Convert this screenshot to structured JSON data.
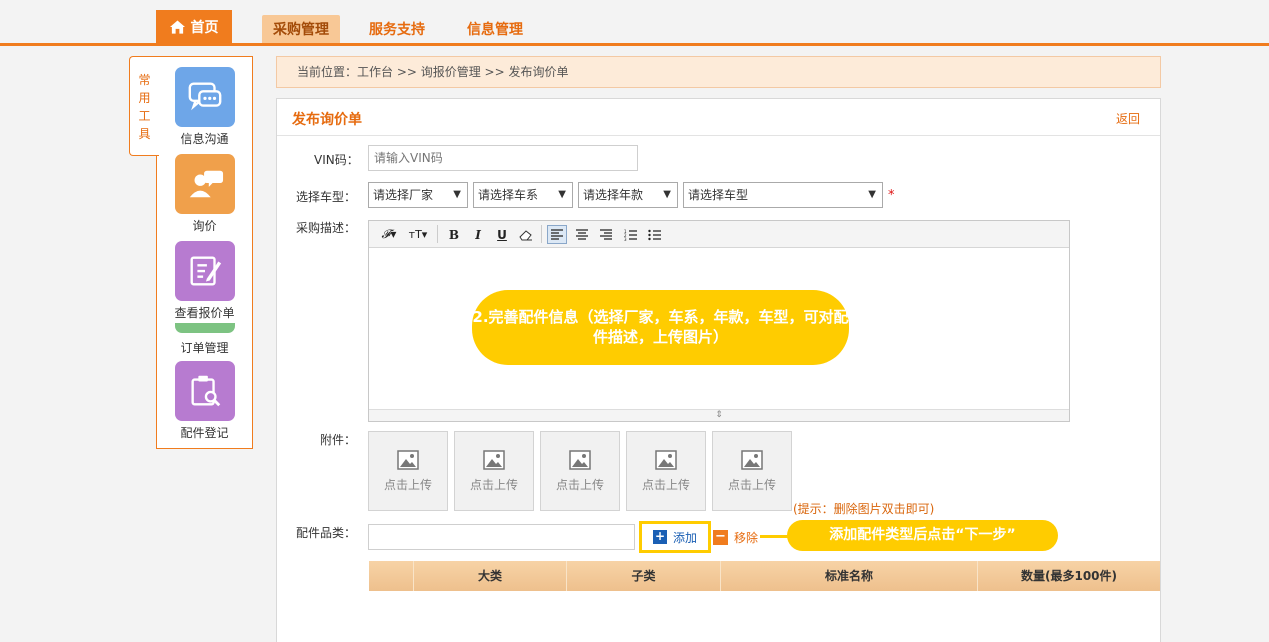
{
  "nav": {
    "home": "首页",
    "tabs": [
      {
        "label": "采购管理",
        "active": true
      },
      {
        "label": "服务支持",
        "active": false
      },
      {
        "label": "信息管理",
        "active": false
      }
    ]
  },
  "sidebar": {
    "tab_label": "常\n用\n工\n具",
    "tools": [
      {
        "label": "信息沟通",
        "icon": "chat-icon"
      },
      {
        "label": "询价",
        "icon": "user-chat-icon"
      },
      {
        "label": "查看报价单",
        "icon": "edit-icon"
      },
      {
        "label": "订单管理",
        "icon": "order-icon"
      },
      {
        "label": "配件登记",
        "icon": "clipboard-search-icon"
      }
    ]
  },
  "breadcrumb": "当前位置：工作台 >> 询报价管理 >> 发布询价单",
  "form": {
    "title": "发布询价单",
    "back": "返回",
    "vin_label": "VIN码：",
    "vin_placeholder": "请输入VIN码",
    "model_label": "选择车型：",
    "selects": [
      "请选择厂家",
      "请选择车系",
      "请选择年款",
      "请选择车型"
    ],
    "required_mark": "*",
    "desc_label": "采购描述：",
    "attach_label": "附件：",
    "upload_text": "点击上传",
    "upload_count": 5,
    "hint": "(提示：删除图片双击即可)",
    "parts_label": "配件品类：",
    "add_btn": "添加",
    "remove_btn": "移除"
  },
  "callouts": {
    "step2": "2.完善配件信息（选择厂家，车系，年款，车型，可对配件描述，上传图片）",
    "add_hint": "添加配件类型后点击“下一步”"
  },
  "table": {
    "headers": [
      "",
      "大类",
      "子类",
      "标准名称",
      "数量(最多100件)"
    ]
  },
  "colors": {
    "accent": "#f07c1e",
    "callout": "#ffcc00",
    "link_blue": "#1a5fb4"
  }
}
